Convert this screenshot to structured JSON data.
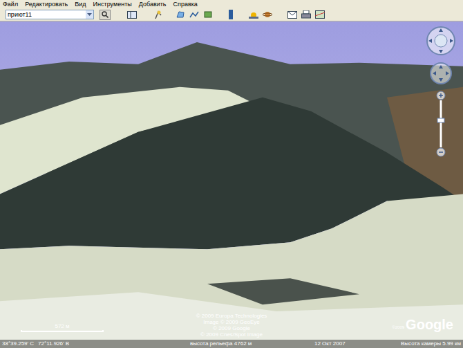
{
  "menu": [
    "Файл",
    "Редактировать",
    "Вид",
    "Инструменты",
    "Добавить",
    "Справка"
  ],
  "search": {
    "value": "приют11"
  },
  "attribution": [
    "© 2009 Europa Technologies",
    "Image © 2009 GeoEye",
    "© 2009 Google",
    "© 2009 Cnes/Spot Image"
  ],
  "logo": {
    "prefix": "©2009",
    "text": "Google"
  },
  "scale": {
    "label": "572 м"
  },
  "status_bar": {
    "latitude": "38°39.259' С",
    "longitude": "72°11.926' В",
    "elevation": "высота рельефа 4762 м",
    "date": "12 Окт 2007",
    "camera": "Высота камеры 5.99 км"
  }
}
